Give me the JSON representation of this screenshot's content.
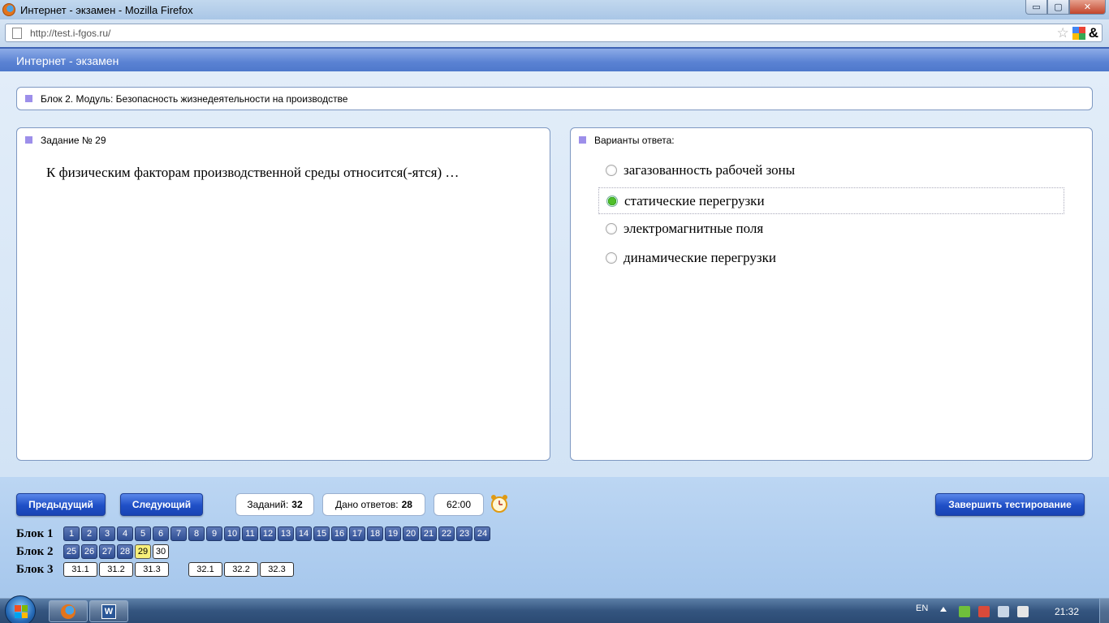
{
  "browser": {
    "window_title": "Интернет - экзамен - Mozilla Firefox",
    "url": "http://test.i-fgos.ru/",
    "win_controls": {
      "minimize": "▭",
      "maximize": "▢",
      "close": "✕"
    },
    "icons": {
      "bookmark": "star-icon",
      "amp": "&"
    }
  },
  "app": {
    "header_title": "Интернет - экзамен",
    "block_title": "Блок 2. Модуль: Безопасность жизнедеятельности на производстве",
    "task": {
      "heading": "Задание № 29",
      "question": "К физическим факторам производственной среды относится(-ятся) …"
    },
    "answers": {
      "heading": "Варианты ответа:",
      "selected_index": 1,
      "options": [
        {
          "label": "загазованность рабочей зоны"
        },
        {
          "label": "статические перегрузки"
        },
        {
          "label": "электромагнитные поля"
        },
        {
          "label": "динамические перегрузки"
        }
      ]
    },
    "controls": {
      "prev_label": "Предыдущий",
      "next_label": "Следующий",
      "finish_label": "Завершить тестирование",
      "tasks_label": "Заданий:",
      "tasks_count": "32",
      "answered_label": "Дано ответов:",
      "answered_count": "28",
      "timer": "62:00"
    },
    "blocks": [
      {
        "label": "Блок 1",
        "items": [
          "1",
          "2",
          "3",
          "4",
          "5",
          "6",
          "7",
          "8",
          "9",
          "10",
          "11",
          "12",
          "13",
          "14",
          "15",
          "16",
          "17",
          "18",
          "19",
          "20",
          "21",
          "22",
          "23",
          "24"
        ]
      },
      {
        "label": "Блок 2",
        "items": [
          "25",
          "26",
          "27",
          "28",
          "29",
          "30"
        ],
        "current": "29",
        "unanswered": [
          "30"
        ]
      },
      {
        "label": "Блок 3",
        "items": [
          "31.1",
          "31.2",
          "31.3",
          "32.1",
          "32.2",
          "32.3"
        ]
      }
    ]
  },
  "taskbar": {
    "language": "EN",
    "time": "21:32",
    "apps": [
      "firefox-icon",
      "word-icon"
    ],
    "word_letter": "W"
  },
  "colors": {
    "header_blue": "#5a82d3",
    "marker_purple": "#9d8fea",
    "button_blue": "#1f4fc6",
    "current_question": "#f7ef7a",
    "selected_radio": "#4fbf2a"
  }
}
